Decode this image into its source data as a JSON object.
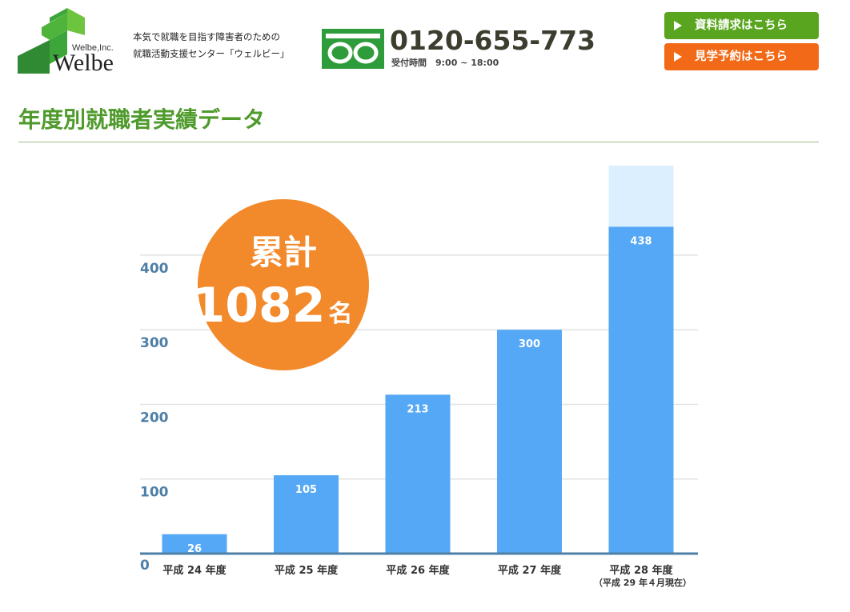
{
  "header": {
    "logo": {
      "company": "Welbe,Inc.",
      "wordmark": "Welbe"
    },
    "tagline": [
      "本気で就職を目指す障害者のための",
      "就職活動支援センター「ウェルビー」"
    ],
    "freedial_icon": "freedial-icon",
    "phone": "0120-655-773",
    "hours": "受付時間　9:00 ~ 18:00",
    "buttons": [
      {
        "label": "資料請求はこちら",
        "color": "#5aa51f",
        "icon": "play-triangle-icon"
      },
      {
        "label": "見学予約はこちら",
        "color": "#f26a18",
        "icon": "play-triangle-icon"
      }
    ]
  },
  "title": "年度別就職者実績データ",
  "total_badge": {
    "label": "累計",
    "value": "1082",
    "unit": "名",
    "color": "#f28a2c"
  },
  "chart_data": {
    "type": "bar",
    "categories": [
      "平成 24 年度",
      "平成 25 年度",
      "平成 26 年度",
      "平成 27 年度",
      "平成 28 年度"
    ],
    "category_notes": [
      "",
      "",
      "",
      "",
      "（平成 29 年４月現在）"
    ],
    "values": [
      26,
      105,
      213,
      300,
      438
    ],
    "data_labels": [
      "26",
      "105",
      "213",
      "300",
      "438"
    ],
    "ylim": [
      0,
      520
    ],
    "yticks": [
      0,
      100,
      200,
      300,
      400
    ],
    "ytick_labels": [
      "0",
      "100",
      "200",
      "300",
      "400"
    ],
    "grid": true,
    "bar_color": "#55a8f5",
    "projection_color": "#dcefff",
    "axis_color": "#4e7fa6",
    "title": "",
    "xlabel": "",
    "ylabel": ""
  }
}
